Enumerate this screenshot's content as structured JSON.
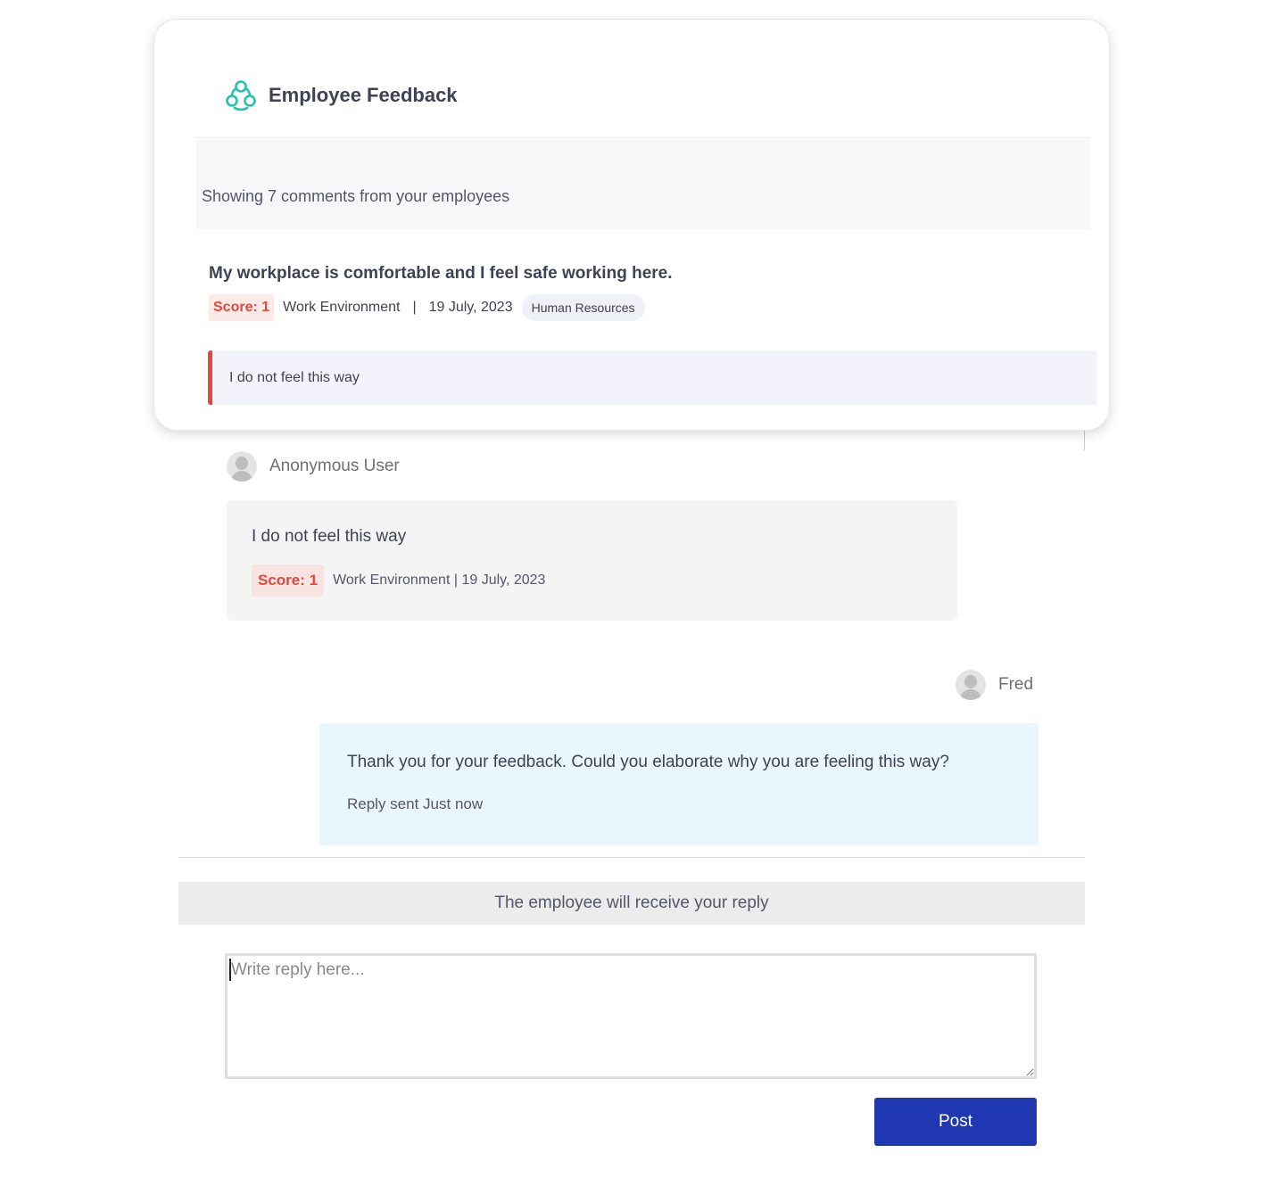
{
  "app": {
    "title": "Employee Feedback",
    "icon": "team-circles-icon",
    "accent_color": "#24c1b0"
  },
  "summary": {
    "text": "Showing 7 comments from your employees"
  },
  "feedback": {
    "title": "My workplace is comfortable and I feel safe working here.",
    "score_label": "Score: 1",
    "category": "Work Environment",
    "separator": "|",
    "date": "19 July, 2023",
    "department": "Human Resources",
    "comment": "I do not feel this way",
    "score_color": "#e04a3a"
  },
  "thread": {
    "employee": {
      "name": "Anonymous User",
      "message": "I do not feel this way",
      "score_label": "Score: 1",
      "meta": "Work Environment | 19 July, 2023"
    },
    "manager": {
      "name": "Fred",
      "message": "Thank you for your feedback. Could you elaborate why you are feeling this way?",
      "status": "Reply sent Just now"
    }
  },
  "reply": {
    "notice": "The employee will receive your reply",
    "placeholder": "Write reply here...",
    "value": "",
    "post_label": "Post",
    "post_color": "#1f38b2"
  }
}
